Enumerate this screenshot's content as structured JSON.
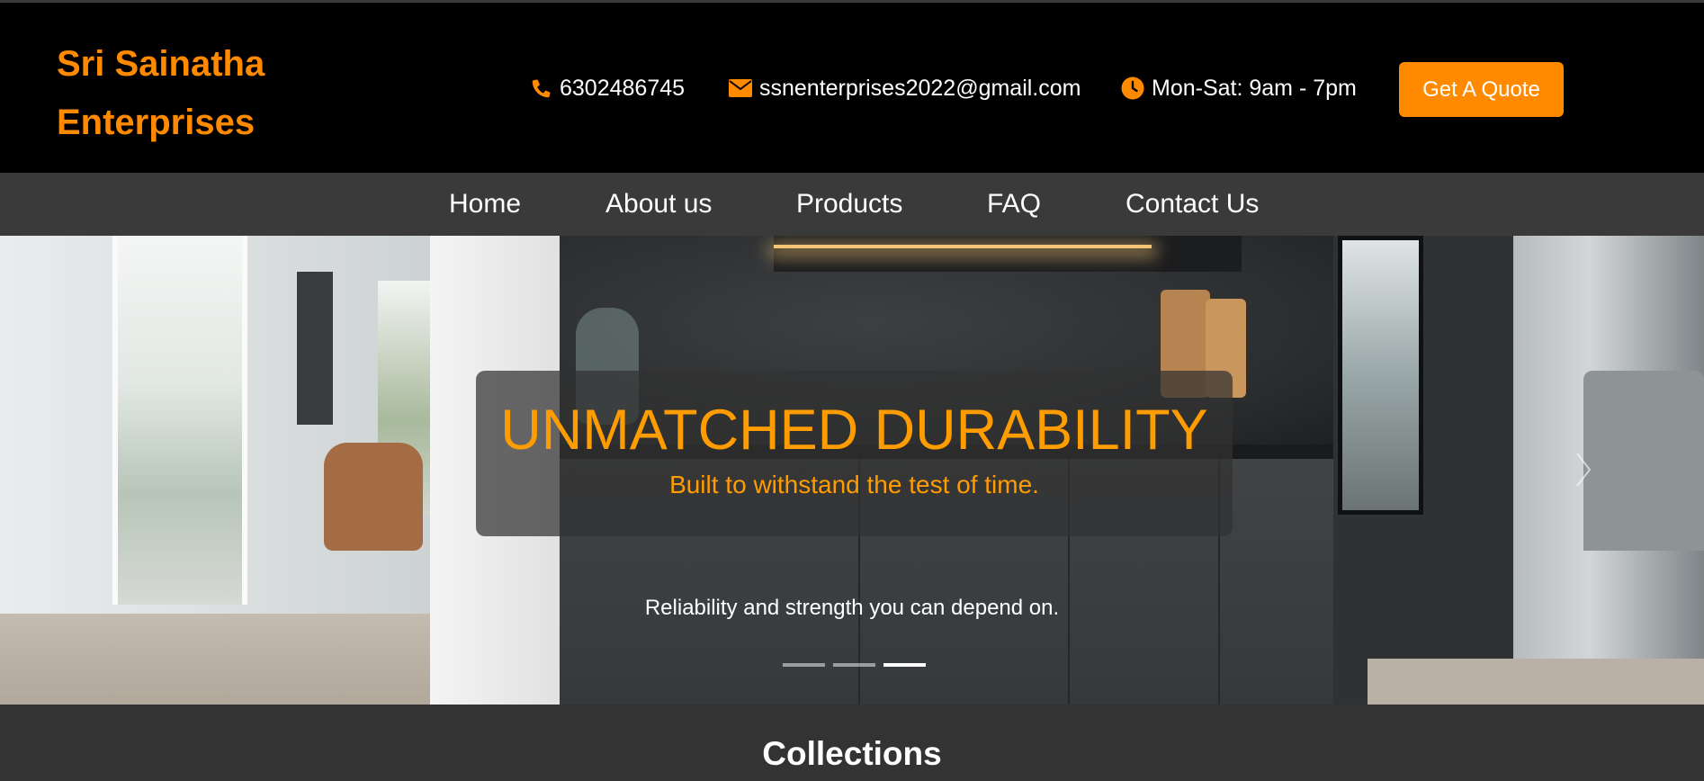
{
  "header": {
    "brand_line1": "Sri Sainatha",
    "brand_line2": "Enterprises",
    "phone": "6302486745",
    "email": "ssnenterprises2022@gmail.com",
    "hours": "Mon-Sat: 9am - 7pm",
    "quote_button": "Get A Quote"
  },
  "nav": {
    "items": [
      {
        "label": "Home"
      },
      {
        "label": "About us"
      },
      {
        "label": "Products"
      },
      {
        "label": "FAQ"
      },
      {
        "label": "Contact Us"
      }
    ]
  },
  "hero": {
    "title": "UNMATCHED DURABILITY",
    "subtitle": "Built to withstand the test of time.",
    "tagline": "Reliability and strength you can depend on.",
    "slide_count": 3,
    "active_slide": 3
  },
  "collections": {
    "title": "Collections"
  },
  "colors": {
    "accent": "#ff8a00",
    "caption_text": "#ff9d00",
    "header_bg": "#000000",
    "nav_bg": "#3a3a3a"
  },
  "icons": {
    "phone": "phone-icon",
    "email": "envelope-icon",
    "hours": "clock-icon",
    "next": "chevron-right-icon"
  }
}
